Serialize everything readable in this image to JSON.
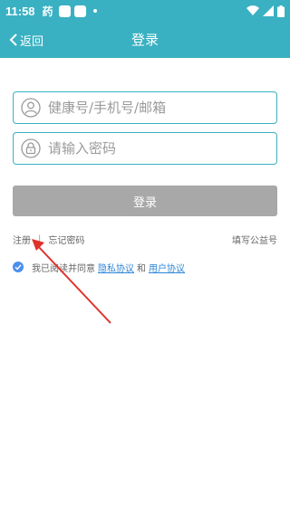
{
  "status_bar": {
    "time": "11:58",
    "app_indicator": "药",
    "icons": [
      "square-notification-icon",
      "square-notification-icon",
      "dot-notification-icon",
      "wifi-icon",
      "signal-icon",
      "battery-icon"
    ]
  },
  "nav": {
    "back_label": "返回",
    "title": "登录"
  },
  "form": {
    "account_placeholder": "健康号/手机号/邮箱",
    "password_placeholder": "请输入密码",
    "login_label": "登录"
  },
  "links": {
    "register": "注册",
    "separator": "|",
    "forgot": "忘记密码",
    "welfare": "填写公益号"
  },
  "agreement": {
    "checked": true,
    "prefix": "我已阅读并同意",
    "privacy": "隐私协议",
    "and": "和",
    "user": "用户协议"
  },
  "colors": {
    "primary": "#3ab1c2",
    "button_disabled": "#a8a8a8",
    "link": "#2f86d8",
    "checkbox": "#4a8ff0",
    "annotation_arrow": "#e0312a"
  }
}
